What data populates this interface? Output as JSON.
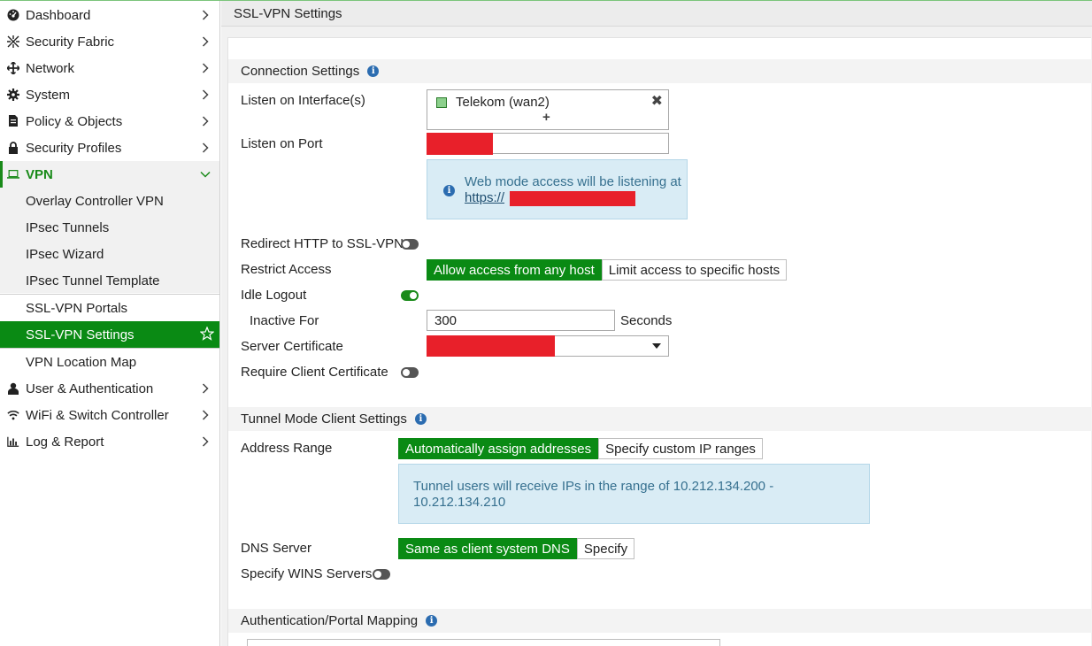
{
  "sidebar": {
    "items": [
      {
        "label": "Dashboard"
      },
      {
        "label": "Security Fabric"
      },
      {
        "label": "Network"
      },
      {
        "label": "System"
      },
      {
        "label": "Policy & Objects"
      },
      {
        "label": "Security Profiles"
      },
      {
        "label": "VPN"
      },
      {
        "label": "Overlay Controller VPN"
      },
      {
        "label": "IPsec Tunnels"
      },
      {
        "label": "IPsec Wizard"
      },
      {
        "label": "IPsec Tunnel Template"
      },
      {
        "label": "SSL-VPN Portals"
      },
      {
        "label": "SSL-VPN Settings"
      },
      {
        "label": "VPN Location Map"
      },
      {
        "label": "User & Authentication"
      },
      {
        "label": "WiFi & Switch Controller"
      },
      {
        "label": "Log & Report"
      }
    ]
  },
  "header": {
    "title": "SSL-VPN Settings"
  },
  "connection": {
    "section_title": "Connection Settings",
    "listen_interface_label": "Listen on Interface(s)",
    "interface_value": "Telekom (wan2)",
    "listen_port_label": "Listen on Port",
    "info_text": "Web mode access will be listening at",
    "info_link": "https://",
    "redirect_label": "Redirect HTTP to SSL-VPN",
    "restrict_label": "Restrict Access",
    "restrict_options": [
      "Allow access from any host",
      "Limit access to specific hosts"
    ],
    "idle_label": "Idle Logout",
    "inactive_label": "Inactive For",
    "inactive_value": "300",
    "seconds_label": "Seconds",
    "cert_label": "Server Certificate",
    "client_cert_label": "Require Client Certificate"
  },
  "tunnel": {
    "section_title": "Tunnel Mode Client Settings",
    "address_label": "Address Range",
    "address_options": [
      "Automatically assign addresses",
      "Specify custom IP ranges"
    ],
    "info_line1": "Tunnel users will receive IPs in the range of 10.212.134.200 -",
    "info_line2": "10.212.134.210",
    "dns_label": "DNS Server",
    "dns_options": [
      "Same as client system DNS",
      "Specify"
    ],
    "wins_label": "Specify WINS Servers"
  },
  "auth": {
    "section_title": "Authentication/Portal Mapping"
  },
  "colors": {
    "accent": "#0a8a14",
    "redaction": "#e8202a",
    "info_bg": "#d9ecf5"
  }
}
